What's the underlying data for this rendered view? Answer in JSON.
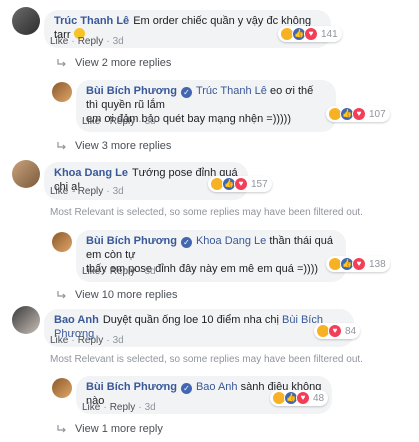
{
  "comments": [
    {
      "author": "Trúc Thanh Lê",
      "text": "Em order chiếc quần y vậy đc không tarr",
      "like": "Like",
      "reply": "Reply",
      "time": "3d",
      "reaction_count": "141"
    },
    {
      "author": "Bùi Bích Phương",
      "tag": "Trúc Thanh Lê",
      "text_line1": "eo ơi thế thì quyền rũ lắm",
      "text_line2": "em ơi đảm bảo quét bay mạng nhện =)))))",
      "like": "Like",
      "reply": "Reply",
      "time": "3d",
      "reaction_count": "107"
    },
    {
      "author": "Khoa Dang Le",
      "text": "Tướng pose đỉnh quá chị ạ!",
      "like": "Like",
      "reply": "Reply",
      "time": "3d",
      "reaction_count": "157"
    },
    {
      "author": "Bùi Bích Phương",
      "tag": "Khoa Dang Le",
      "text_line1": "thần thái quá em còn tự",
      "text_line2": "thấy em pose đỉnh đây này em mê em quá =))))",
      "like": "Like",
      "reply": "Reply",
      "time": "3d",
      "reaction_count": "138"
    },
    {
      "author": "Bao Anh",
      "text": "Duyệt quần ống loe 10 điểm nha chị",
      "tag": "Bùi Bích Phương",
      "like": "Like",
      "reply": "Reply",
      "time": "3d",
      "reaction_count": "84"
    },
    {
      "author": "Bùi Bích Phương",
      "tag": "Bao Anh",
      "text": "sành điệu không nào",
      "like": "Like",
      "reply": "Reply",
      "time": "3d",
      "reaction_count": "48"
    }
  ],
  "view_more": {
    "v1": "View 2 more replies",
    "v2": "View 3 more replies",
    "v3": "View 10 more replies",
    "v4": "View 1 more reply"
  },
  "notice": "Most Relevant is selected, so some replies may have been filtered out.",
  "colors": {
    "link": "#385898",
    "bubble": "#f2f3f5",
    "meta": "#90949c"
  }
}
